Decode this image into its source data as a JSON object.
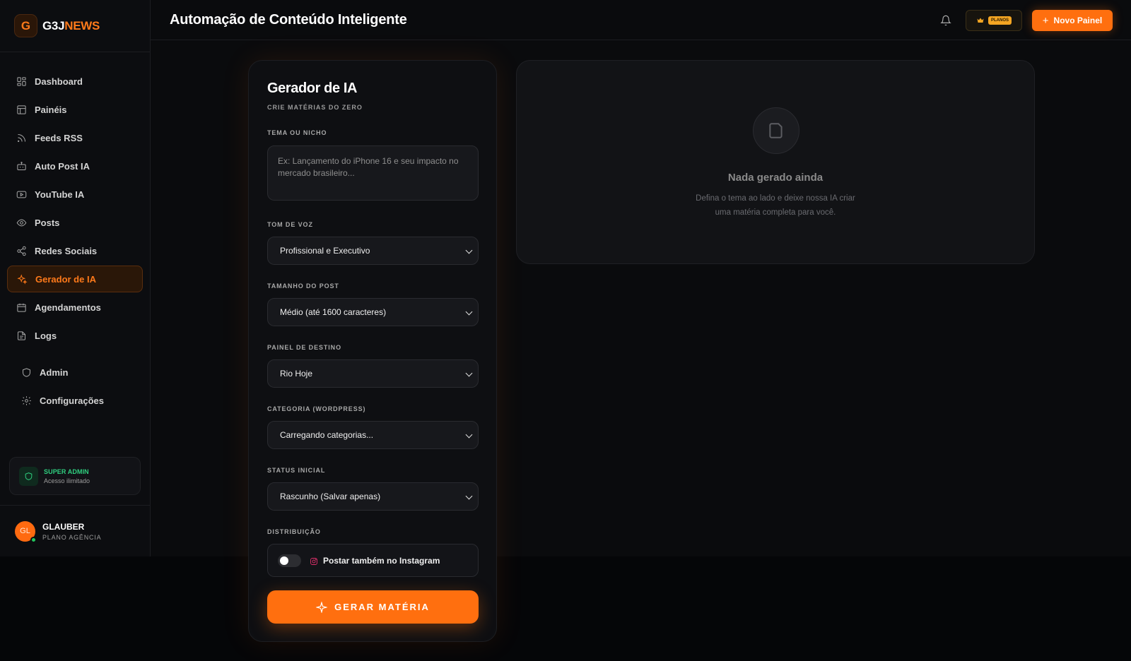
{
  "brand": {
    "logo_letter": "G",
    "name_part1": "G3J",
    "name_part2": "NEWS"
  },
  "sidebar": {
    "items": [
      {
        "label": "Dashboard",
        "icon": "grid-icon"
      },
      {
        "label": "Painéis",
        "icon": "layout-icon"
      },
      {
        "label": "Feeds RSS",
        "icon": "rss-icon"
      },
      {
        "label": "Auto Post IA",
        "icon": "bot-icon"
      },
      {
        "label": "YouTube IA",
        "icon": "youtube-icon"
      },
      {
        "label": "Posts",
        "icon": "eye-icon"
      },
      {
        "label": "Redes Sociais",
        "icon": "share-icon"
      },
      {
        "label": "Gerador de IA",
        "icon": "sparkles-icon",
        "active": true
      },
      {
        "label": "Agendamentos",
        "icon": "calendar-icon"
      },
      {
        "label": "Logs",
        "icon": "file-icon"
      }
    ],
    "admin_items": [
      {
        "label": "Admin",
        "icon": "shield-icon"
      },
      {
        "label": "Configurações",
        "icon": "gear-icon"
      }
    ],
    "super_admin": {
      "title": "SUPER ADMIN",
      "subtitle": "Acesso ilimitado"
    },
    "user": {
      "initials": "GL",
      "name": "GLAUBER",
      "plan": "PLANO AGÊNCIA"
    }
  },
  "header": {
    "title": "Automação de Conteúdo Inteligente",
    "plans_badge": "PLANOS",
    "new_panel_label": "Novo Painel"
  },
  "generator": {
    "title": "Gerador de IA",
    "subtitle": "CRIE MATÉRIAS DO ZERO",
    "topic_label": "TEMA OU NICHO",
    "topic_placeholder": "Ex: Lançamento do iPhone 16 e seu impacto no mercado brasileiro...",
    "tone_label": "TOM DE VOZ",
    "tone_value": "Profissional e Executivo",
    "size_label": "TAMANHO DO POST",
    "size_value": "Médio (até 1600 caracteres)",
    "panel_label": "PAINEL DE DESTINO",
    "panel_value": "Rio Hoje",
    "category_label": "CATEGORIA (WORDPRESS)",
    "category_value": "Carregando categorias...",
    "status_label": "STATUS INICIAL",
    "status_value": "Rascunho (Salvar apenas)",
    "distribution_label": "DISTRIBUIÇÃO",
    "instagram_label": "Postar também no Instagram",
    "instagram_enabled": false,
    "generate_label": "GERAR MATÉRIA"
  },
  "result": {
    "empty_title": "Nada gerado ainda",
    "empty_line1": "Defina o tema ao lado e deixe nossa IA criar",
    "empty_line2": "uma matéria completa para você."
  },
  "colors": {
    "accent": "#ff6f0f",
    "success": "#2fcf7f",
    "gold": "#f5a623"
  }
}
